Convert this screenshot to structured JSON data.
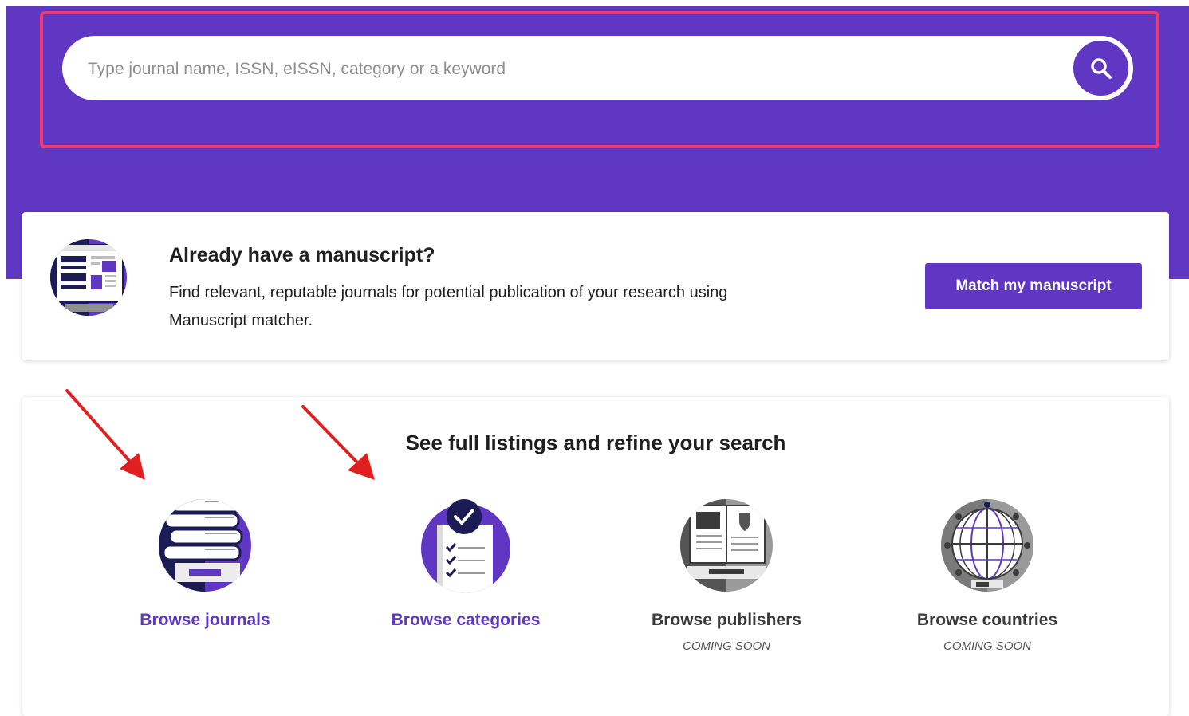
{
  "search": {
    "placeholder": "Type journal name, ISSN, eISSN, category or a keyword",
    "value": ""
  },
  "manuscript": {
    "title": "Already have a manuscript?",
    "description": "Find relevant, reputable journals for potential publication of your research using Manuscript matcher.",
    "button_label": "Match my manuscript"
  },
  "listings": {
    "title": "See full listings and refine your search",
    "items": [
      {
        "label": "Browse journals",
        "icon": "books-icon",
        "subtitle": ""
      },
      {
        "label": "Browse categories",
        "icon": "checklist-icon",
        "subtitle": ""
      },
      {
        "label": "Browse publishers",
        "icon": "publisher-book-icon",
        "subtitle": "COMING SOON"
      },
      {
        "label": "Browse countries",
        "icon": "globe-icon",
        "subtitle": "COMING SOON"
      }
    ]
  },
  "colors": {
    "primary": "#5f37c2",
    "highlight": "#ef3b72",
    "arrow": "#e02020",
    "navy": "#1b1b55"
  }
}
